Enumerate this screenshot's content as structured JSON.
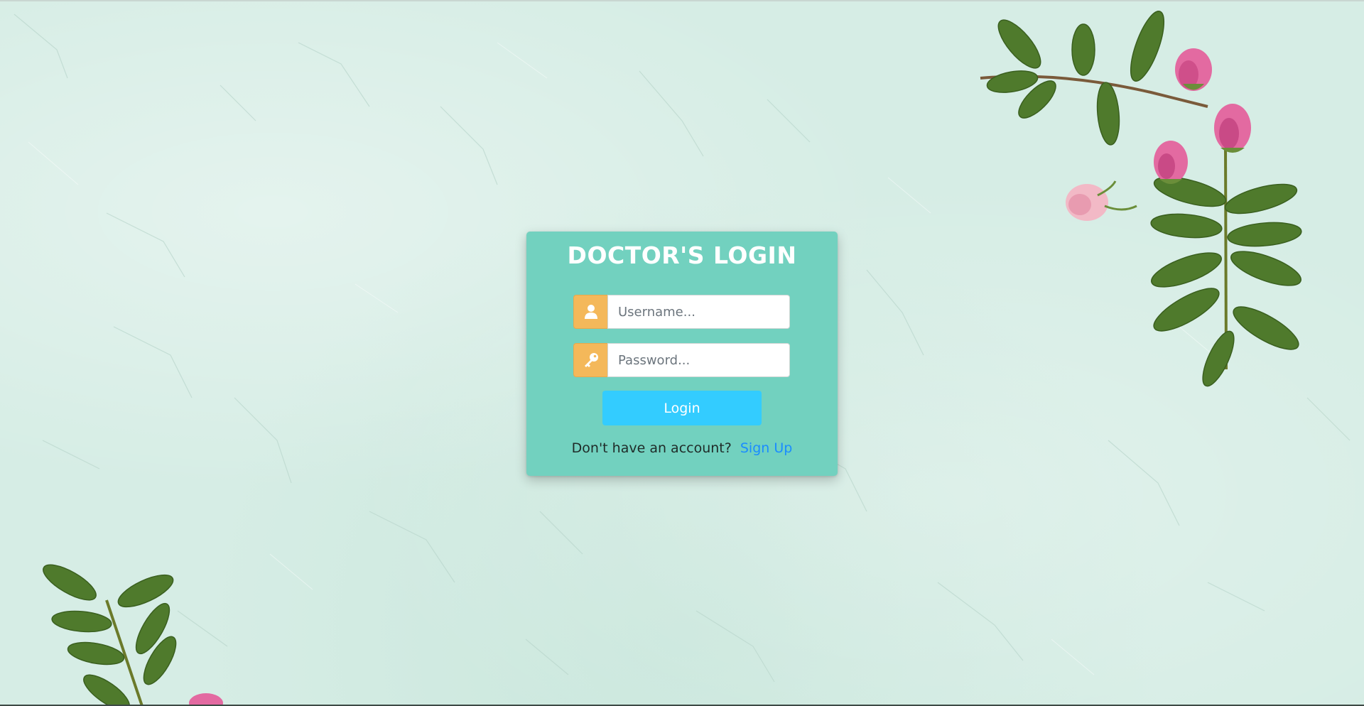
{
  "login": {
    "title": "DOCTOR'S LOGIN",
    "username": {
      "placeholder": "Username...",
      "value": "",
      "icon": "user-icon"
    },
    "password": {
      "placeholder": "Password...",
      "value": "",
      "icon": "key-icon"
    },
    "button_label": "Login",
    "signup_prompt": "Don't have an account?",
    "signup_link": "Sign Up"
  },
  "theme": {
    "background": "#d6ede5",
    "card": "#72d1bf",
    "addon": "#f4b85a",
    "button": "#33ccff",
    "link": "#1a8cff"
  }
}
